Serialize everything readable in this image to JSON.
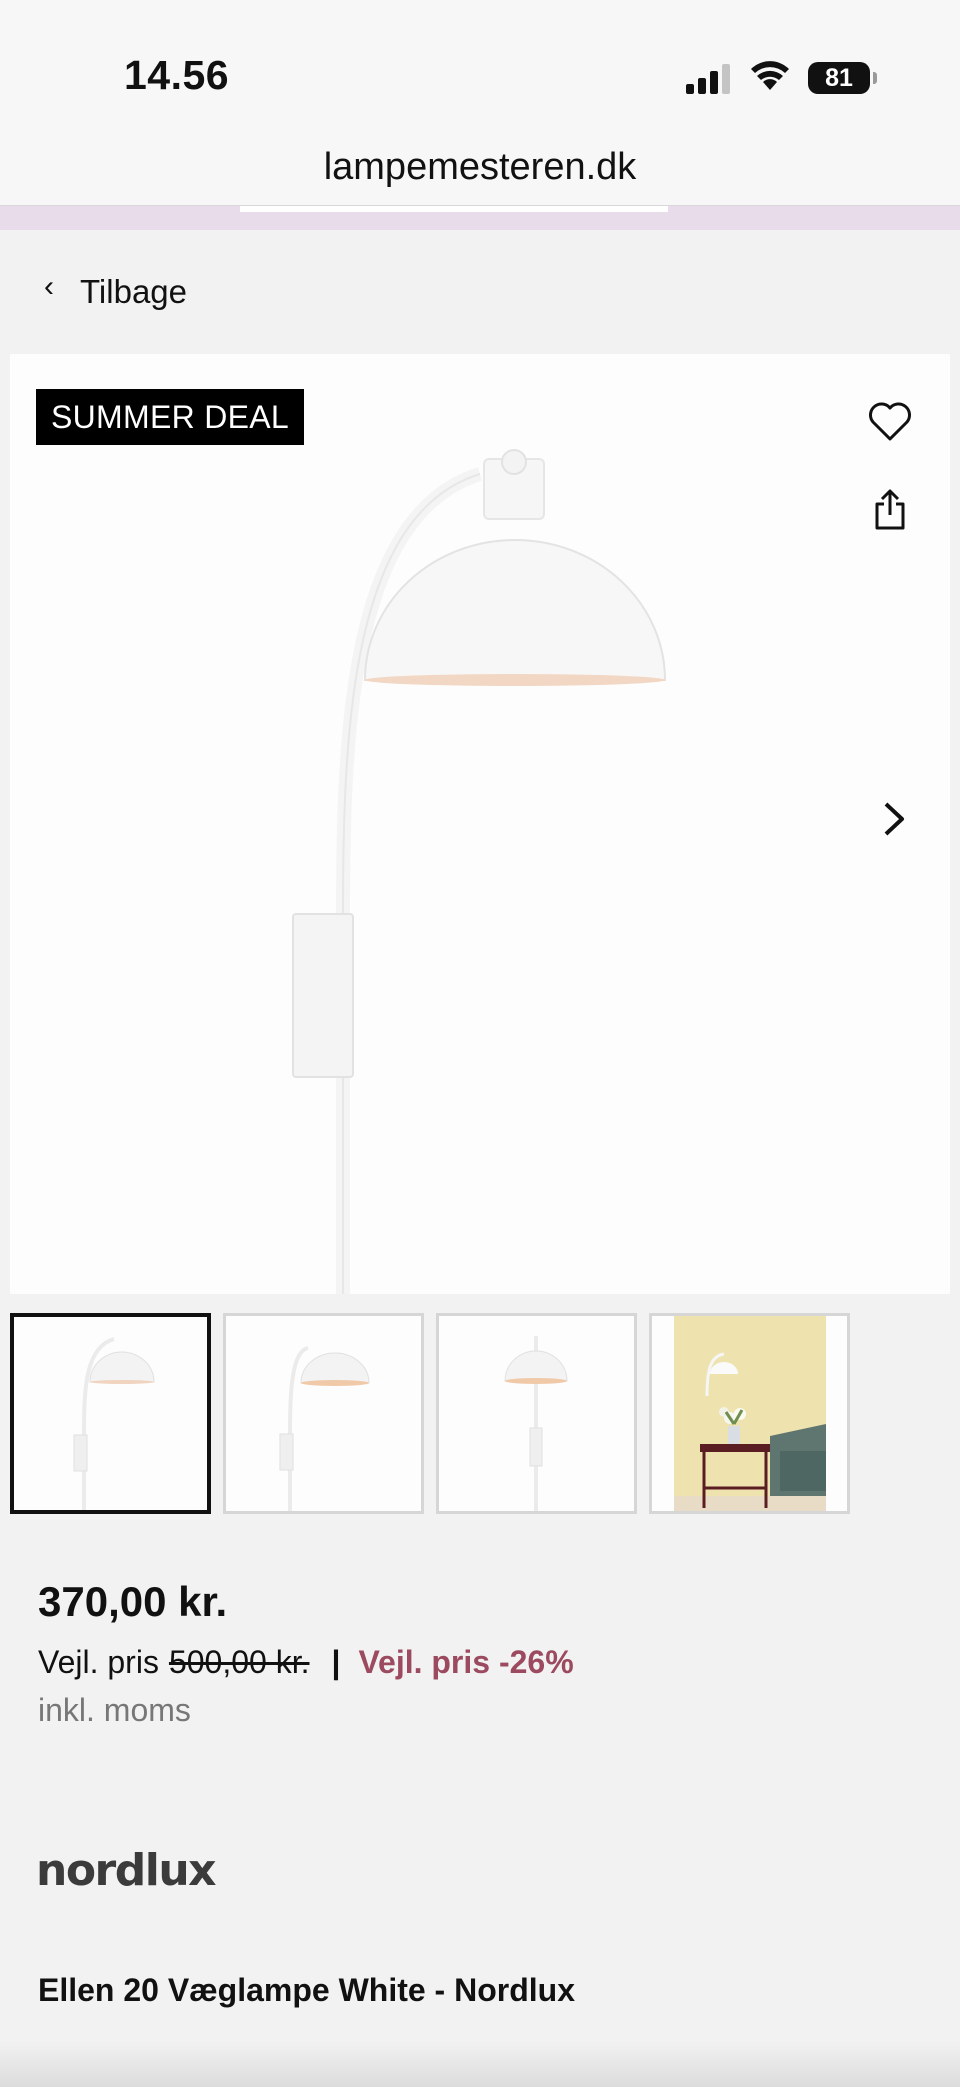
{
  "status_bar": {
    "time": "14.56",
    "battery": "81"
  },
  "browser": {
    "url": "lampemesteren.dk"
  },
  "nav": {
    "back_label": "Tilbage"
  },
  "product": {
    "badge": "SUMMER DEAL",
    "price": "370,00 kr.",
    "rrp_label": "Vejl. pris",
    "rrp_old": "500,00 kr.",
    "separator": "|",
    "discount": "Vejl. pris -26%",
    "vat": "inkl. moms",
    "brand": "nordlux",
    "title": "Ellen 20 Væglampe White - Nordlux",
    "thumbnail_count": 4,
    "selected_thumbnail": 1
  },
  "icons": {
    "heart": "heart-icon",
    "share": "share-icon",
    "next": "chevron-right-icon",
    "back": "chevron-left-icon"
  },
  "colors": {
    "discount": "#9c4a5f",
    "badge_bg": "#000000",
    "page_bg": "#f2f2f2"
  }
}
